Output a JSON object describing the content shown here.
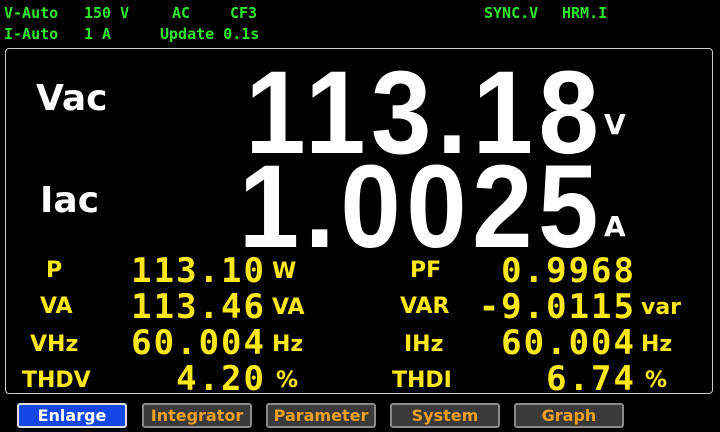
{
  "status": {
    "v_range": "V-Auto",
    "v_value": "150 V",
    "mode": "AC",
    "crest": "CF3",
    "i_range": "I-Auto",
    "i_value": "1 A",
    "update": "Update 0.1s",
    "sync": "SYNC.V",
    "harmonic": "HRM.I"
  },
  "main": {
    "vac_label": "Vac",
    "vac_value": "113.18",
    "vac_unit": "V",
    "iac_label": "Iac",
    "iac_value": "1.0025",
    "iac_unit": "A"
  },
  "measurements": [
    {
      "label": "P",
      "value": "113.10",
      "unit": "W"
    },
    {
      "label": "PF",
      "value": "0.9968",
      "unit": ""
    },
    {
      "label": "VA",
      "value": "113.46",
      "unit": "VA"
    },
    {
      "label": "VAR",
      "value": "-9.0115",
      "unit": "var"
    },
    {
      "label": "VHz",
      "value": "60.004",
      "unit": "Hz"
    },
    {
      "label": "IHz",
      "value": "60.004",
      "unit": "Hz"
    },
    {
      "label": "THDV",
      "value": "4.20",
      "unit": "%"
    },
    {
      "label": "THDI",
      "value": "6.74",
      "unit": "%"
    }
  ],
  "softkeys": [
    {
      "label": "Enlarge",
      "active": true
    },
    {
      "label": "Integrator",
      "active": false
    },
    {
      "label": "Parameter",
      "active": false
    },
    {
      "label": "System",
      "active": false
    },
    {
      "label": "Graph",
      "active": false
    }
  ],
  "colors": {
    "status": "#2ee82e",
    "values": "#ffe81a",
    "active_key": "#1447e6",
    "key_text": "#f0a020"
  }
}
